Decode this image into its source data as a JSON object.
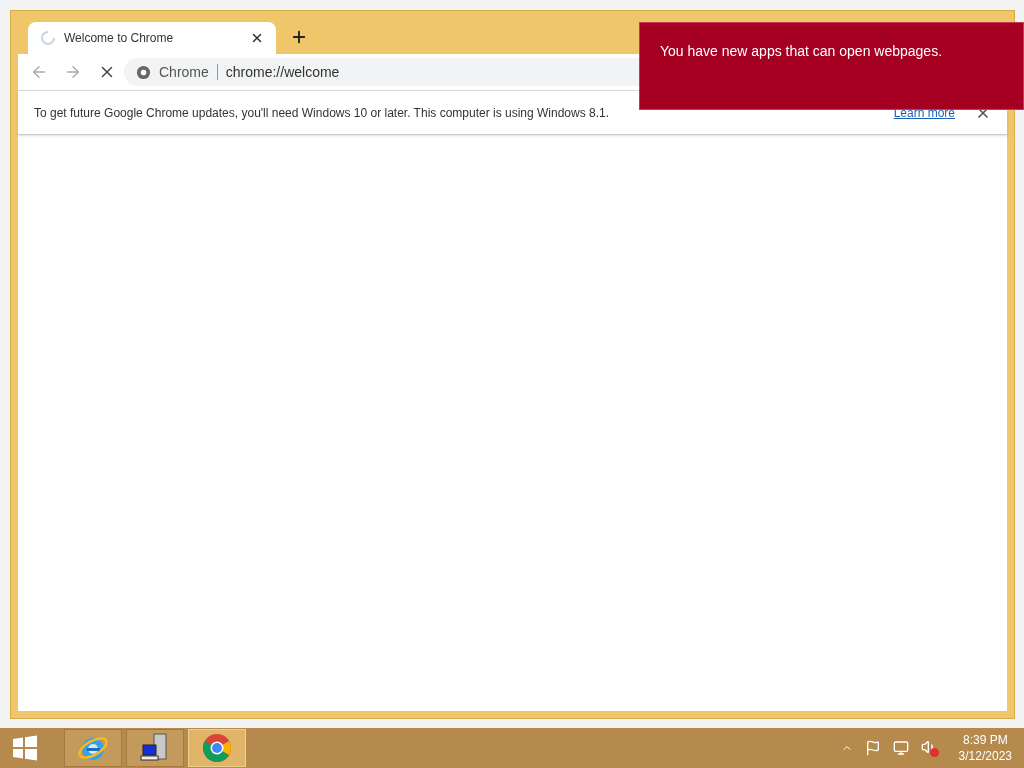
{
  "browser": {
    "tab": {
      "title": "Welcome to Chrome"
    },
    "omnibox": {
      "chip": "Chrome",
      "url": "chrome://welcome"
    },
    "infobar": {
      "message": "To get future Google Chrome updates, you'll need Windows 10 or later. This computer is using Windows 8.1.",
      "link": "Learn more"
    }
  },
  "toast": {
    "message": "You have new apps that can open webpages."
  },
  "taskbar": {
    "apps": [
      {
        "kind": "ie",
        "selected": false
      },
      {
        "kind": "server",
        "selected": false
      },
      {
        "kind": "chrome",
        "selected": true
      }
    ],
    "clock": {
      "time": "8:39 PM",
      "date": "3/12/2023"
    }
  }
}
